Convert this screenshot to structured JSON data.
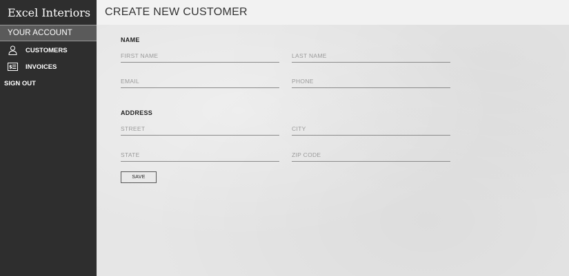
{
  "sidebar": {
    "brand": "Excel Interiors",
    "account_header": "YOUR ACCOUNT",
    "items": [
      {
        "label": "CUSTOMERS",
        "icon": "user-icon"
      },
      {
        "label": "INVOICES",
        "icon": "invoice-icon"
      }
    ],
    "signout": "SIGN OUT"
  },
  "header": {
    "title": "CREATE NEW CUSTOMER"
  },
  "form": {
    "name_section": "NAME",
    "address_section": "ADDRESS",
    "first_name": {
      "placeholder": "FIRST NAME",
      "value": ""
    },
    "last_name": {
      "placeholder": "LAST NAME",
      "value": ""
    },
    "email": {
      "placeholder": "EMAIL",
      "value": ""
    },
    "phone": {
      "placeholder": "PHONE",
      "value": ""
    },
    "street": {
      "placeholder": "STREET",
      "value": ""
    },
    "city": {
      "placeholder": "CITY",
      "value": ""
    },
    "state": {
      "placeholder": "STATE",
      "value": ""
    },
    "zip": {
      "placeholder": "ZIP CODE",
      "value": ""
    },
    "save_label": "SAVE"
  },
  "colors": {
    "sidebar_bg": "#2e2e2e",
    "account_header_bg": "#5a5a5a",
    "main_bg": "#e6e6e6",
    "topbar_bg": "#f2f2f2"
  }
}
